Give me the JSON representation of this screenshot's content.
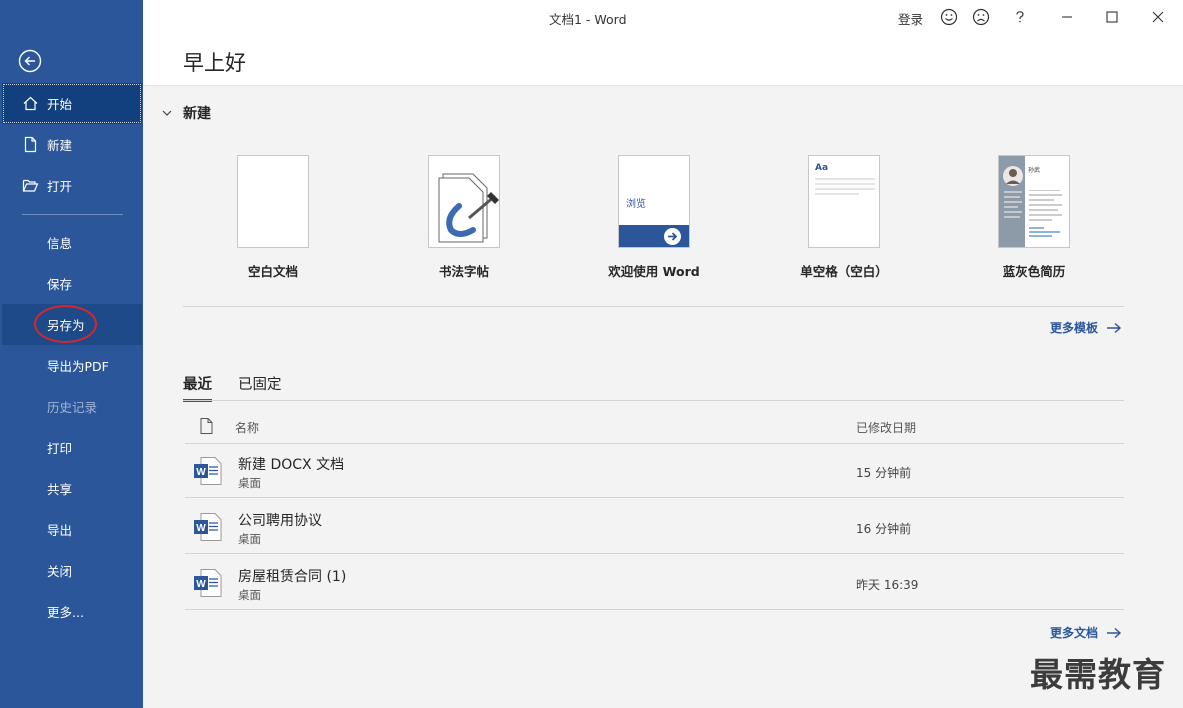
{
  "window": {
    "title": "文档1  -  Word",
    "login": "登录"
  },
  "sidebar": {
    "items": [
      {
        "label": "开始",
        "icon": "home-icon"
      },
      {
        "label": "新建",
        "icon": "new-doc-icon"
      },
      {
        "label": "打开",
        "icon": "folder-open-icon"
      },
      {
        "label": "信息"
      },
      {
        "label": "保存"
      },
      {
        "label": "另存为"
      },
      {
        "label": "导出为PDF"
      },
      {
        "label": "历史记录"
      },
      {
        "label": "打印"
      },
      {
        "label": "共享"
      },
      {
        "label": "导出"
      },
      {
        "label": "关闭"
      },
      {
        "label": "更多..."
      }
    ]
  },
  "header": {
    "greeting": "早上好"
  },
  "new_section": {
    "title": "新建",
    "templates": [
      {
        "caption": "空白文档"
      },
      {
        "caption": "书法字帖"
      },
      {
        "caption": "欢迎使用 Word",
        "thumb_text": "浏览"
      },
      {
        "caption": "单空格（空白）",
        "thumb_text": "Aa"
      },
      {
        "caption": "蓝灰色简历",
        "thumb_text": "孙武"
      }
    ],
    "more_templates": "更多模板"
  },
  "recent": {
    "tabs": [
      "最近",
      "已固定"
    ],
    "columns": {
      "name": "名称",
      "modified": "已修改日期"
    },
    "files": [
      {
        "name": "新建 DOCX 文档",
        "location": "桌面",
        "date": "15 分钟前"
      },
      {
        "name": "公司聘用协议",
        "location": "桌面",
        "date": "16 分钟前"
      },
      {
        "name": "房屋租赁合同 (1)",
        "location": "桌面",
        "date": "昨天 16:39"
      }
    ],
    "more_docs": "更多文档"
  },
  "watermark": "最需教育",
  "colors": {
    "accent": "#2b579a",
    "annotation": "#d9262b"
  }
}
